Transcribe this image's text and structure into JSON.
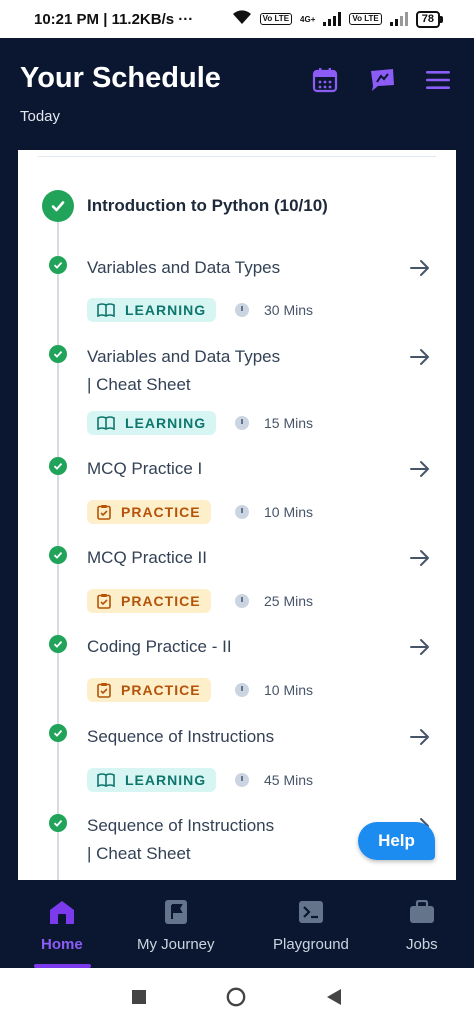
{
  "status_bar": {
    "time_speed": "10:21 PM | 11.2KB/s",
    "dots": "···",
    "network_type": "4G+",
    "volte_label": "Vo LTE",
    "battery": "78"
  },
  "header": {
    "title": "Your Schedule",
    "subtitle": "Today",
    "icons": [
      "calendar-icon",
      "chat-icon",
      "menu-icon"
    ],
    "accent_color": "#8b5cf6"
  },
  "course": {
    "title": "Introduction to Python (10/10)",
    "status": "completed"
  },
  "items": [
    {
      "title": "Variables and Data Types",
      "badge": "LEARNING",
      "duration": "30 Mins"
    },
    {
      "title_line1": "Variables and Data Types",
      "title_line2": "| Cheat Sheet",
      "badge": "LEARNING",
      "duration": "15 Mins"
    },
    {
      "title": "MCQ Practice I",
      "badge": "PRACTICE",
      "duration": "10 Mins"
    },
    {
      "title": "MCQ Practice II",
      "badge": "PRACTICE",
      "duration": "25 Mins"
    },
    {
      "title": "Coding Practice - II",
      "badge": "PRACTICE",
      "duration": "10 Mins"
    },
    {
      "title": "Sequence of Instructions",
      "badge": "LEARNING",
      "duration": "45 Mins"
    },
    {
      "title_line1": "Sequence of Instructions",
      "title_line2": "| Cheat Sheet"
    }
  ],
  "help_button": "Help",
  "bottom_nav": {
    "items": [
      {
        "label": "Home",
        "icon": "home-icon",
        "active": true
      },
      {
        "label": "My Journey",
        "icon": "flag-icon",
        "active": false
      },
      {
        "label": "Playground",
        "icon": "terminal-icon",
        "active": false
      },
      {
        "label": "Jobs",
        "icon": "briefcase-icon",
        "active": false
      }
    ]
  },
  "colors": {
    "header_bg": "#0b1730",
    "success_green": "#22a35a",
    "learning_bg": "#d7f6f3",
    "learning_text": "#0f766e",
    "practice_bg": "#fdefc9",
    "practice_text": "#b45309",
    "help_blue": "#1d8cf0"
  }
}
